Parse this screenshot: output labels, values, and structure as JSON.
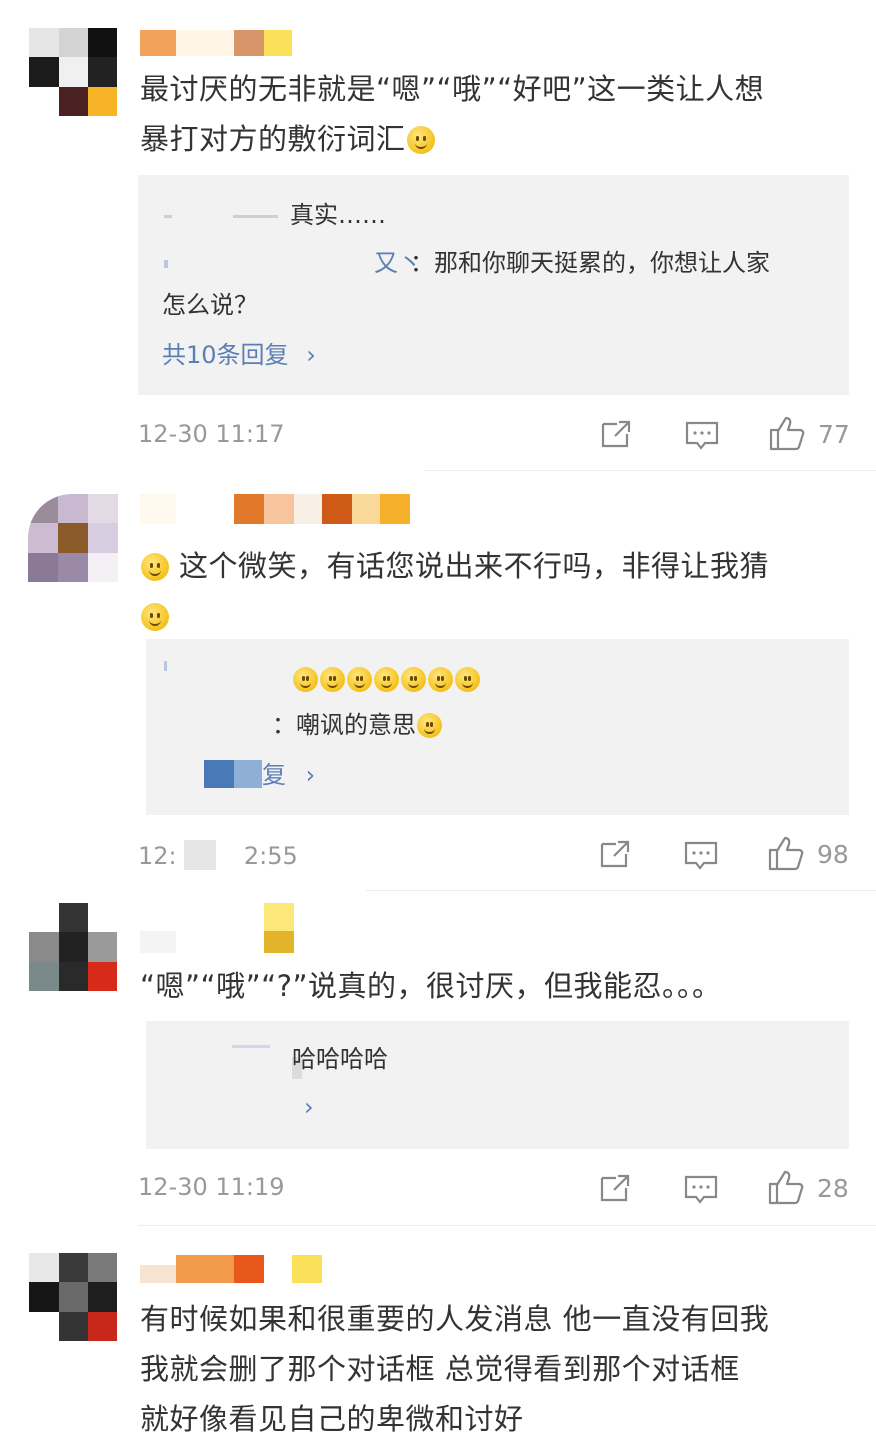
{
  "comments": [
    {
      "text_line1": "最讨厌的无非就是“嗯”“哦”“好吧”这一类让人想",
      "text_line2": "暴打对方的敷衍词汇",
      "replies": [
        {
          "text": "真实……"
        },
        {
          "text_a": "：那和你聊天挺累的，你想让人家",
          "suffix_visible": "又丶",
          "text_b": "怎么说？"
        }
      ],
      "more_label": "共10条回复",
      "time": "12-30 11:17",
      "likes": "77"
    },
    {
      "text": "这个微笑，有话您说出来不行吗，非得让我猜",
      "replies": [
        {
          "text": ""
        },
        {
          "text": "：嘲讽的意思"
        }
      ],
      "more_label": "复",
      "time_left": "12:",
      "time_right": "2:55",
      "likes": "98"
    },
    {
      "text": "“嗯”“哦”“?”说真的，很讨厌，但我能忍。。。",
      "replies": [
        {
          "text": "哈哈哈哈"
        }
      ],
      "more_label": "",
      "time": "12-30 11:19",
      "likes": "28"
    },
    {
      "text_line1": "有时候如果和很重要的人发消息 他一直没有回我",
      "text_line2": "我就会删了那个对话框 总觉得看到那个对话框",
      "text_line3": "就好像看见自己的卑微和讨好"
    }
  ],
  "icons": {
    "share": "share-icon",
    "comment": "comment-icon",
    "like": "thumbs-up-icon",
    "chevron": "chevron-right-icon",
    "emoji_shrug": "shrug-emoji-icon",
    "emoji_smile": "smile-emoji-icon"
  },
  "colors": {
    "link": "#5b7fb5",
    "muted": "#999999",
    "reply_bg": "#f2f2f2"
  }
}
